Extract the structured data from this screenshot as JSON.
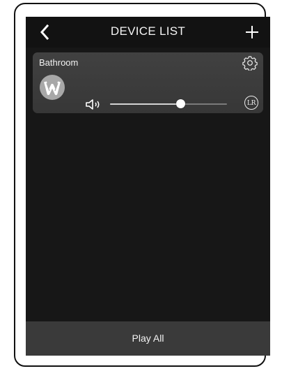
{
  "header": {
    "title": "DEVICE LIST",
    "back_icon": "chevron-left-icon",
    "add_icon": "plus-icon"
  },
  "devices": [
    {
      "name": "Bathroom",
      "settings_icon": "gear-icon",
      "logo_icon": "w-logo-icon",
      "volume_icon": "speaker-icon",
      "volume_fraction": 0.6,
      "channel_label": "LR"
    }
  ],
  "footer": {
    "play_all_label": "Play All"
  },
  "colors": {
    "screen_background": "#171717",
    "card_background": "#3b3b3b",
    "bottom_bar": "#3a3a3a",
    "text": "#f4f4f4"
  }
}
